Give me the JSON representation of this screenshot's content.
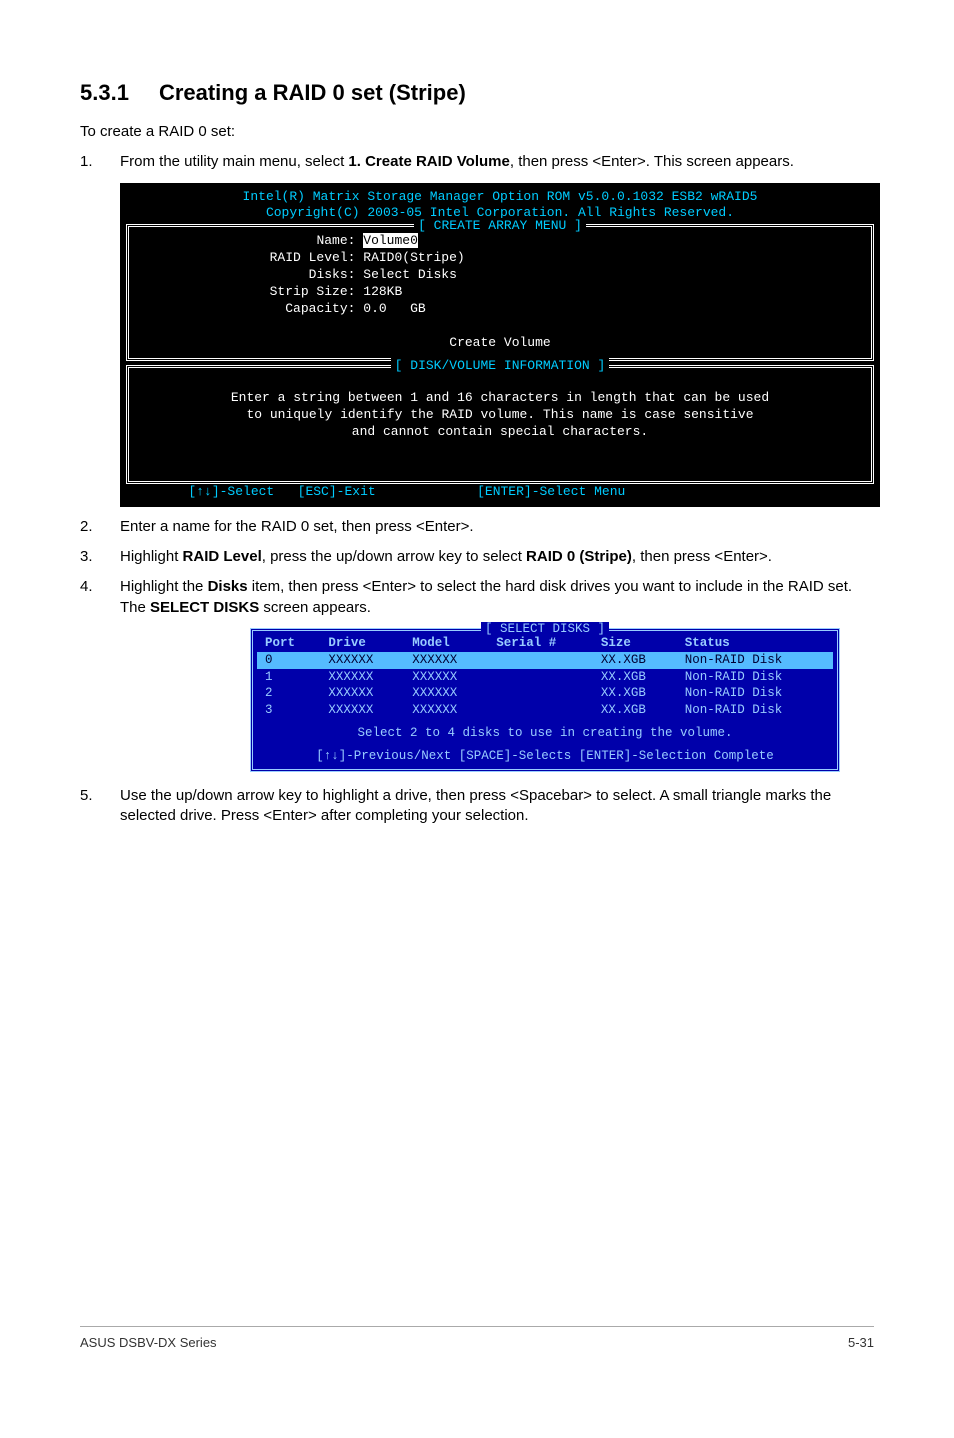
{
  "section": {
    "number": "5.3.1",
    "title": "Creating a RAID 0 set (Stripe)"
  },
  "intro": "To create a RAID 0 set:",
  "steps": {
    "s1_num": "1.",
    "s1_a": "From the utility main menu, select ",
    "s1_b": "1. Create RAID Volume",
    "s1_c": ", then press <Enter>. This screen appears.",
    "s2_num": "2.",
    "s2": "Enter a name for the RAID 0 set, then press <Enter>.",
    "s3_num": "3.",
    "s3_a": "Highlight ",
    "s3_b": "RAID Level",
    "s3_c": ", press the up/down arrow key to select ",
    "s3_d": "RAID 0 (Stripe)",
    "s3_e": ", then press <Enter>.",
    "s4_num": "4.",
    "s4_a": "Highlight the ",
    "s4_b": "Disks",
    "s4_c": " item, then press <Enter> to select the hard disk drives you want to include in the RAID set. The ",
    "s4_d": "SELECT DISKS",
    "s4_e": " screen appears.",
    "s5_num": "5.",
    "s5": "Use the up/down arrow key to highlight a drive, then press <Spacebar> to select. A small triangle marks the selected drive. Press <Enter> after completing your selection."
  },
  "bios1": {
    "header1": "Intel(R) Matrix Storage Manager Option ROM v5.0.0.1032 ESB2 wRAID5",
    "header2": "Copyright(C) 2003-05 Intel Corporation. All Rights Reserved.",
    "menu_title": "[ CREATE ARRAY MENU ]",
    "fields": {
      "name_label": "Name:",
      "name_value": "Volume0",
      "raid_label": "RAID Level:",
      "raid_value": "RAID0(Stripe)",
      "disks_label": "Disks:",
      "disks_value": "Select Disks",
      "strip_label": "Strip Size:",
      "strip_value": "128KB",
      "cap_label": "Capacity:",
      "cap_value": "0.0   GB"
    },
    "create_volume": "Create Volume",
    "info_title": "[ DISK/VOLUME INFORMATION ]",
    "info_text1": "Enter a string between 1 and 16 characters in length that can be used",
    "info_text2": "to uniquely identify the RAID volume. This name is case sensitive",
    "info_text3": "and cannot contain special characters.",
    "nav_select": "[↑↓]-Select",
    "nav_exit": "[ESC]-Exit",
    "nav_enter": "[ENTER]-Select Menu"
  },
  "bios2": {
    "title": "[ SELECT DISKS ]",
    "headers": {
      "port": "Port",
      "drive": "Drive",
      "model": "Model",
      "serial": "Serial #",
      "size": "Size",
      "status": "Status"
    },
    "rows": [
      {
        "port": "0",
        "drive": "XXXXXX",
        "model": "XXXXXX",
        "serial": "",
        "size": "XX.XGB",
        "status": "Non-RAID Disk"
      },
      {
        "port": "1",
        "drive": "XXXXXX",
        "model": "XXXXXX",
        "serial": "",
        "size": "XX.XGB",
        "status": "Non-RAID Disk"
      },
      {
        "port": "2",
        "drive": "XXXXXX",
        "model": "XXXXXX",
        "serial": "",
        "size": "XX.XGB",
        "status": "Non-RAID Disk"
      },
      {
        "port": "3",
        "drive": "XXXXXX",
        "model": "XXXXXX",
        "serial": "",
        "size": "XX.XGB",
        "status": "Non-RAID Disk"
      }
    ],
    "hint": "Select 2 to 4 disks to use in creating the volume.",
    "nav": "[↑↓]-Previous/Next  [SPACE]-Selects  [ENTER]-Selection Complete"
  },
  "footer": {
    "left": "ASUS DSBV-DX Series",
    "right": "5-31"
  }
}
